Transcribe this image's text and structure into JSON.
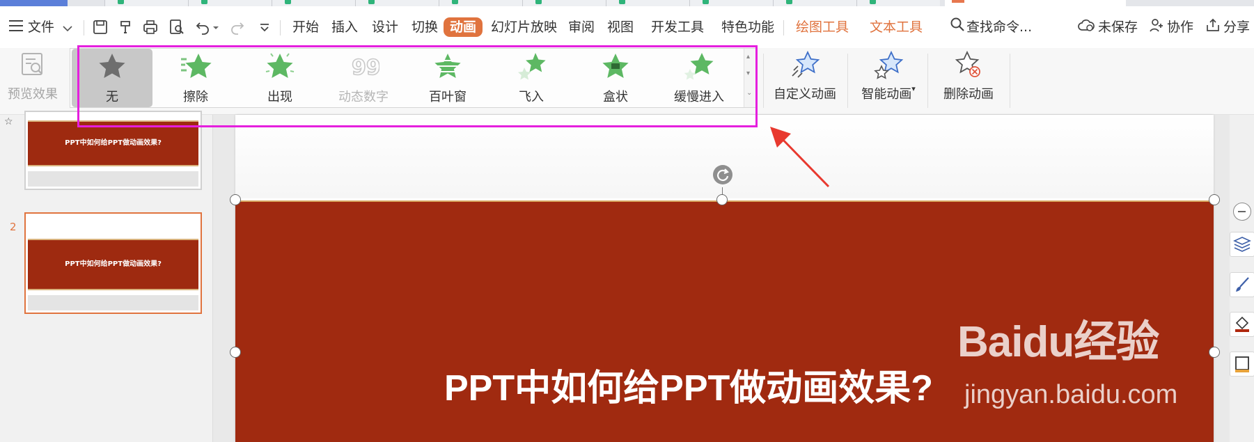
{
  "menubar": {
    "file_menu": "文件",
    "tabs": [
      {
        "label": "开始"
      },
      {
        "label": "插入"
      },
      {
        "label": "设计"
      },
      {
        "label": "切换"
      },
      {
        "label": "动画",
        "active": true
      },
      {
        "label": "幻灯片放映"
      },
      {
        "label": "审阅"
      },
      {
        "label": "视图"
      },
      {
        "label": "开发工具"
      },
      {
        "label": "特色功能"
      }
    ],
    "context_tabs": [
      {
        "label": "绘图工具"
      },
      {
        "label": "文本工具"
      }
    ],
    "search": {
      "label": "查找命令..."
    },
    "status": {
      "unsaved": "未保存",
      "collaborate": "协作",
      "share": "分享"
    }
  },
  "ribbon": {
    "preview_label": "预览效果",
    "gallery": [
      {
        "label": "无",
        "selected": true
      },
      {
        "label": "擦除"
      },
      {
        "label": "出现"
      },
      {
        "label": "动态数字",
        "disabled": true
      },
      {
        "label": "百叶窗"
      },
      {
        "label": "飞入"
      },
      {
        "label": "盒状"
      },
      {
        "label": "缓慢进入"
      }
    ],
    "custom_animation_label": "自定义动画",
    "smart_animation_label": "智能动画",
    "delete_animation_label": "删除动画"
  },
  "slides_panel": {
    "slides": [
      {
        "number": "",
        "title": "PPT中如何给PPT做动画效果?"
      },
      {
        "number": "2",
        "title": "PPT中如何给PPT做动画效果?"
      }
    ]
  },
  "slide": {
    "title": "PPT中如何给PPT做动画效果?"
  },
  "watermark": {
    "brand": "Baidu经验",
    "url": "jingyan.baidu.com"
  },
  "colors": {
    "accent": "#e0733e",
    "slide_red": "#a02a10",
    "highlight": "#e51fde",
    "annotation_arrow": "#e8392f"
  }
}
